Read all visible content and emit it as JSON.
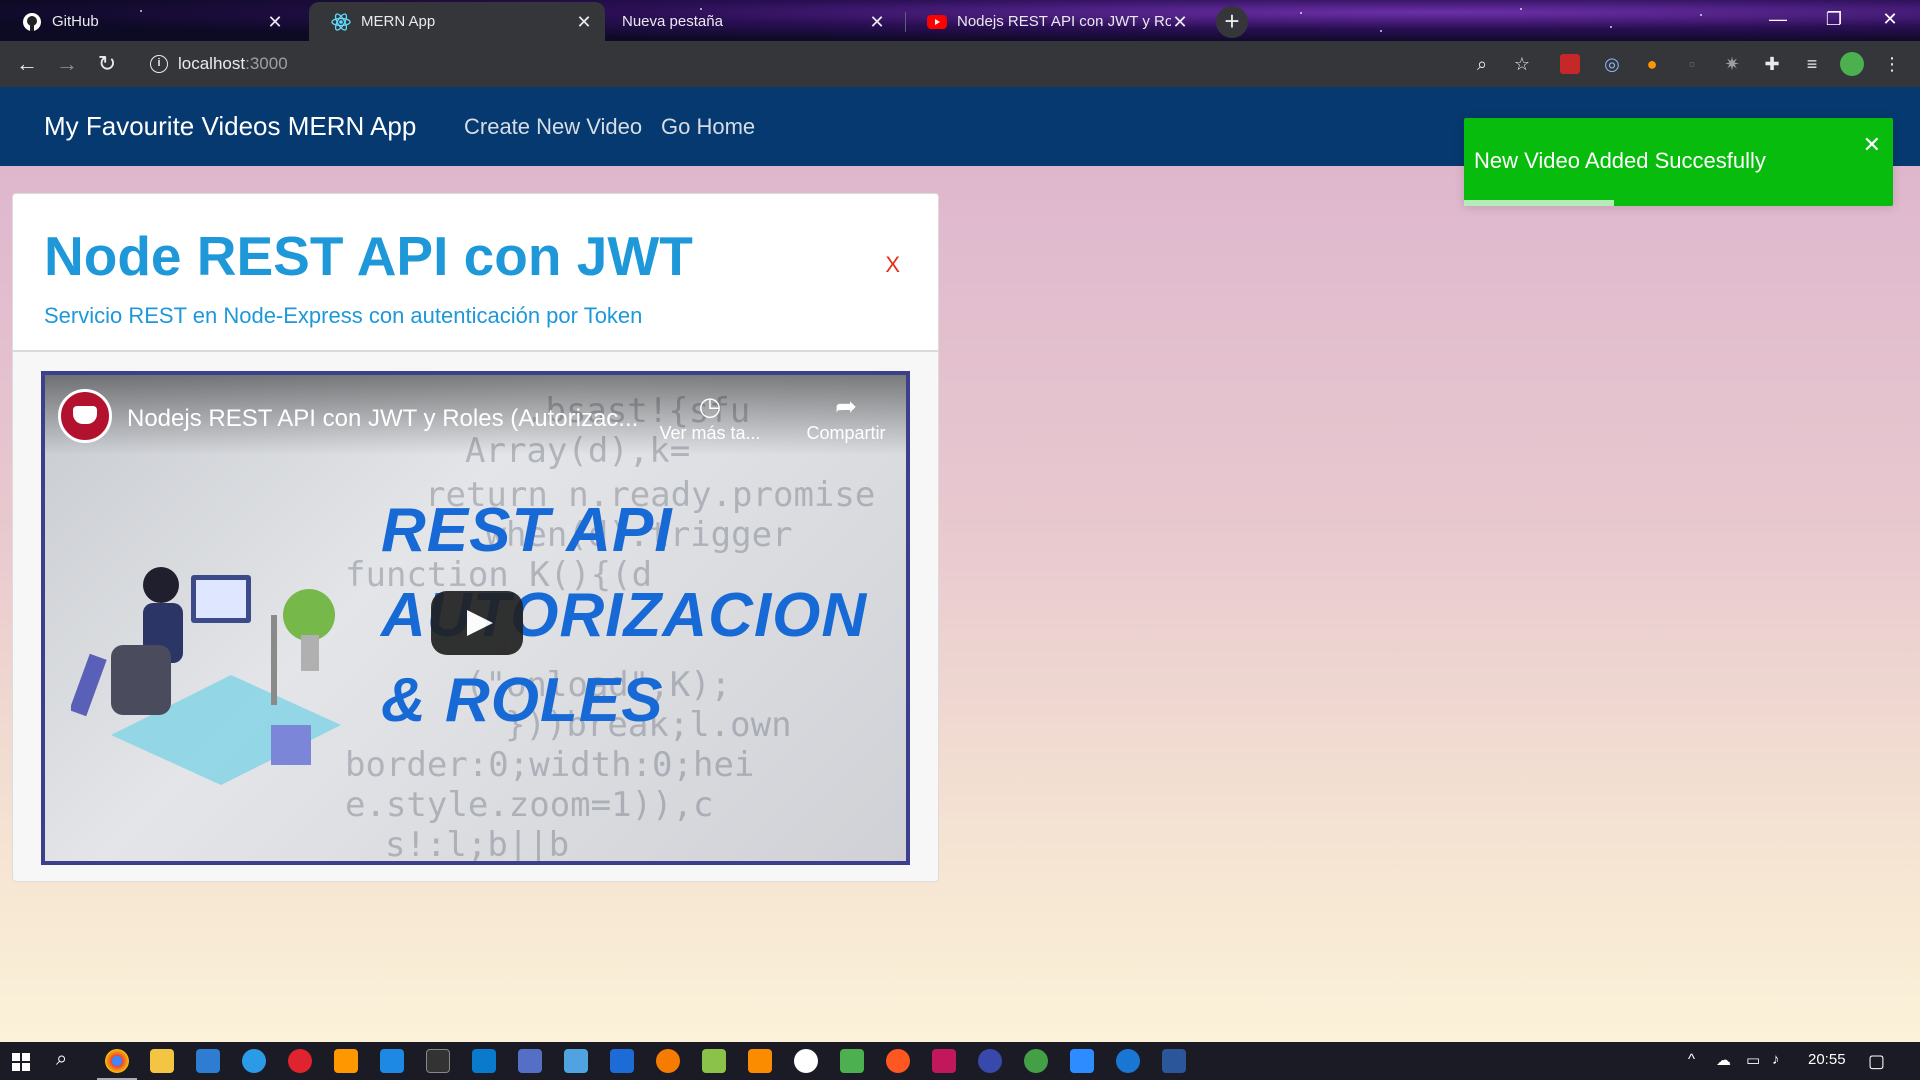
{
  "browser": {
    "tabs": [
      {
        "title": "GitHub",
        "icon": "github-icon"
      },
      {
        "title": "MERN App",
        "icon": "react-icon"
      },
      {
        "title": "Nueva pestaña",
        "icon": ""
      },
      {
        "title": "Nodejs REST API con JWT y Role",
        "icon": "youtube-icon"
      }
    ],
    "active_tab": 1,
    "url_host": "localhost",
    "url_port": ":3000",
    "new_tab_label": "+"
  },
  "app": {
    "brand": "My Favourite Videos MERN App",
    "nav": [
      "Create New Video",
      "Go Home"
    ]
  },
  "toast": {
    "message": "New Video Added Succesfully",
    "close": "✕",
    "progress": 0.35,
    "color": "#07bc0c"
  },
  "video_card": {
    "title": "Node REST API con JWT",
    "description": "Servicio REST en Node-Express con autenticación por Token",
    "delete_label": "X",
    "embed": {
      "title": "Nodejs REST API con JWT y Roles (Autorizac...",
      "watch_later": "Ver más ta...",
      "share": "Compartir",
      "thumbnail_lines": [
        "REST API",
        "AUTORIZACION",
        "& ROLES"
      ]
    }
  },
  "taskbar": {
    "clock": "20:55"
  },
  "colors": {
    "navbar": "#06396f",
    "accent": "#1e98d8",
    "delete": "#e0321b"
  }
}
